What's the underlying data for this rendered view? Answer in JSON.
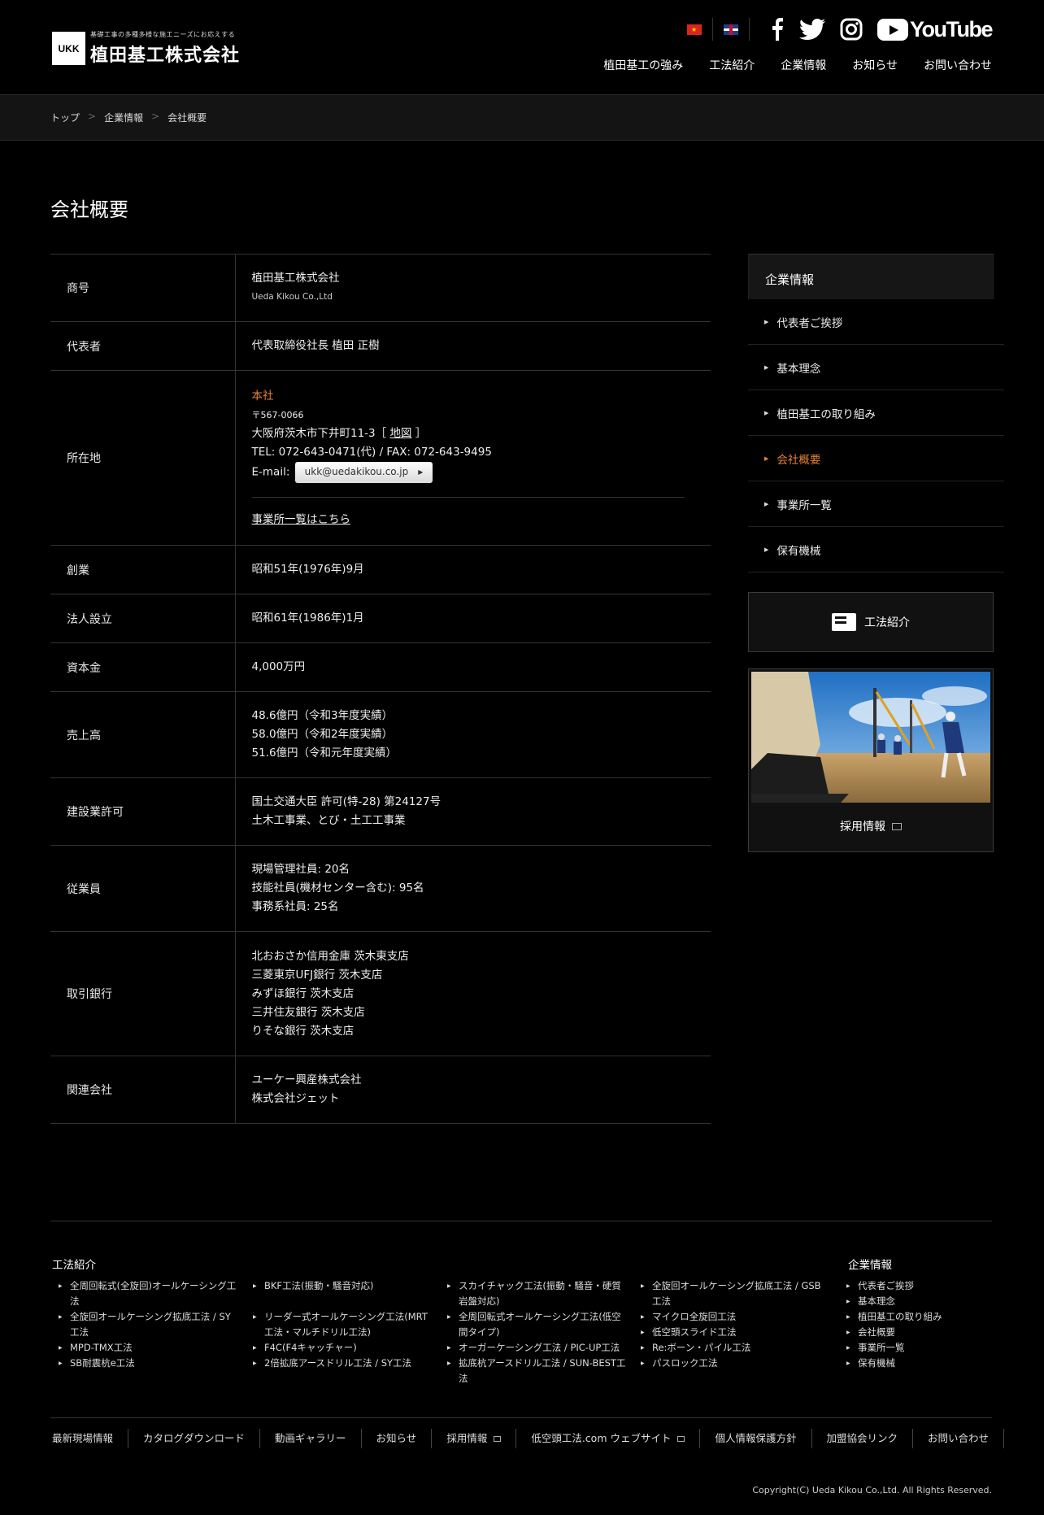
{
  "header": {
    "logo_tagline": "基礎工事の多種多様な施工ニーズにお応えする",
    "logo_name": "植田基工株式会社",
    "logo_mark": "UKK",
    "youtube_label": "YouTube",
    "nav": [
      "植田基工の強み",
      "工法紹介",
      "企業情報",
      "お知らせ",
      "お問い合わせ"
    ]
  },
  "breadcrumb": [
    "トップ",
    "企業情報",
    "会社概要"
  ],
  "page_title": "会社概要",
  "table": {
    "trade_name_label": "商号",
    "trade_name": "植田基工株式会社",
    "trade_name_en": "Ueda Kikou Co.,Ltd",
    "rep_label": "代表者",
    "rep": "代表取締役社長 植田 正樹",
    "location_label": "所在地",
    "hq_label": "本社",
    "postal": "〒567-0066",
    "address": "大阪府茨木市下井町11-3［",
    "map_link": "地図",
    "address_end": "］",
    "tel": "TEL: 072-643-0471(代) / FAX: 072-643-9495",
    "email_label": "E-mail:",
    "email": "ukk@uedakikou.co.jp",
    "offices_link": "事業所一覧はこちら",
    "founded_label": "創業",
    "founded": "昭和51年(1976年)9月",
    "incorporated_label": "法人設立",
    "incorporated": "昭和61年(1986年)1月",
    "capital_label": "資本金",
    "capital": "4,000万円",
    "sales_label": "売上高",
    "sales": [
      "48.6億円（令和3年度実績）",
      "58.0億円（令和2年度実績）",
      "51.6億円（令和元年度実績）"
    ],
    "license_label": "建設業許可",
    "license": [
      "国土交通大臣 許可(特-28) 第24127号",
      "土木工事業、とび・土工工事業"
    ],
    "employees_label": "従業員",
    "employees": [
      "現場管理社員: 20名",
      "技能社員(機材センター含む): 95名",
      "事務系社員: 25名"
    ],
    "banks_label": "取引銀行",
    "banks": [
      "北おおさか信用金庫 茨木東支店",
      "三菱東京UFJ銀行 茨木支店",
      "みずほ銀行 茨木支店",
      "三井住友銀行 茨木支店",
      "りそな銀行 茨木支店"
    ],
    "related_label": "関連会社",
    "related": [
      "ユーケー興産株式会社",
      "株式会社ジェット"
    ]
  },
  "sidebar": {
    "title": "企業情報",
    "items": [
      "代表者ご挨拶",
      "基本理念",
      "植田基工の取り組み",
      "会社概要",
      "事業所一覧",
      "保有機械"
    ],
    "active_index": 3,
    "method_label": "工法紹介",
    "recruit_label": "採用情報"
  },
  "footer": {
    "methods_title": "工法紹介",
    "methods_col1": [
      "全周回転式(全旋回)オールケーシング工法",
      "全旋回オールケーシング拡底工法 / SY工法",
      "MPD-TMX工法",
      "SB耐震杭e工法"
    ],
    "methods_col2": [
      "BKF工法(振動・騒音対応)",
      "リーダー式オールケーシング工法(MRT工法・マルチドリル工法)",
      "F4C(F4キャッチャー)",
      "2倍拡底アースドリル工法 / SY工法"
    ],
    "methods_col3": [
      "スカイチャック工法(振動・騒音・硬質岩盤対応)",
      "全周回転式オールケーシング工法(低空間タイプ)",
      "オーガーケーシング工法 / PIC-UP工法",
      "拡底杭アースドリル工法 / SUN-BEST工法"
    ],
    "methods_col4": [
      "全旋回オールケーシング拡底工法 / GSB工法",
      "マイクロ全旋回工法",
      "低空頭スライド工法",
      "Re:ボーン・パイル工法",
      "パスロック工法"
    ],
    "company_title": "企業情報",
    "company_items": [
      "代表者ご挨拶",
      "基本理念",
      "植田基工の取り組み",
      "会社概要",
      "事業所一覧",
      "保有機械"
    ],
    "links": [
      "最新現場情報",
      "カタログダウンロード",
      "動画ギャラリー",
      "お知らせ",
      "採用情報",
      "低空頭工法.com ウェブサイト",
      "個人情報保護方針",
      "加盟協会リンク",
      "お問い合わせ"
    ],
    "copyright": "Copyright(C) Ueda Kikou Co.,Ltd. All Rights Reserved."
  }
}
